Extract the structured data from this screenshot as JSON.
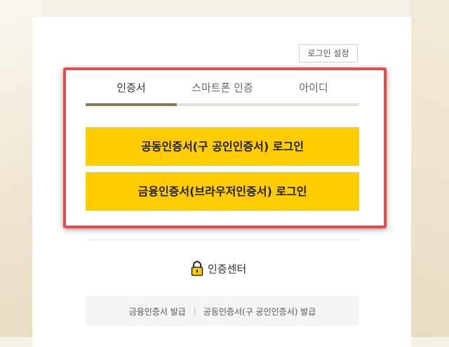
{
  "settings_button": "로그인 설정",
  "tabs": [
    {
      "label": "인증서"
    },
    {
      "label": "스마트폰 인증"
    },
    {
      "label": "아이디"
    }
  ],
  "buttons": {
    "joint_cert": "공동인증서(구 공인인증서) 로그인",
    "financial_cert": "금융인증서(브라우저인증서) 로그인"
  },
  "cert_center": {
    "label": "인증센터",
    "icon": "lock-icon"
  },
  "bottom_links": [
    {
      "label": "금융인증서 발급"
    },
    {
      "label": "공동인증서(구 공인인증서) 발급"
    }
  ],
  "colors": {
    "accent_yellow": "#ffcc00",
    "tab_indicator": "#8a7a52",
    "highlight_border": "#e84b4b"
  }
}
